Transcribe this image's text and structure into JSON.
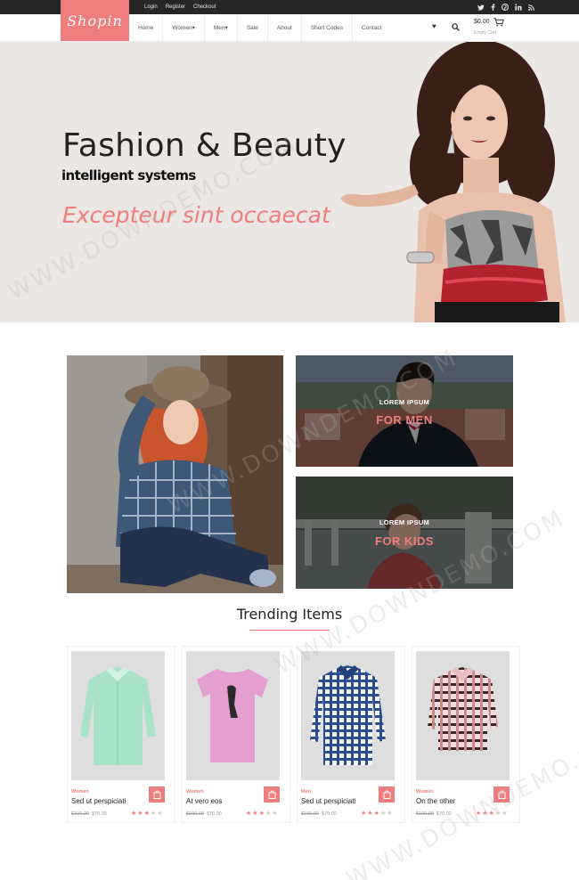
{
  "topbar": {
    "links": [
      "Login",
      "Register",
      "Checkout"
    ],
    "social": [
      "twitter-icon",
      "facebook-icon",
      "pinterest-icon",
      "linkedin-icon",
      "rss-icon"
    ]
  },
  "logo": {
    "text": "Shopin"
  },
  "nav": {
    "items": [
      "Home",
      "Women▾",
      "Men▾",
      "Sale",
      "About",
      "Short Codes",
      "Contact"
    ]
  },
  "cart": {
    "price": "$0.00",
    "status": "Empty Cart"
  },
  "hero": {
    "title": "Fashion & Beauty",
    "subtitle": "intelligent systems",
    "tagline": "Excepteur sint occaecat"
  },
  "promos": {
    "men": {
      "kicker": "LOREM IPSUM",
      "title": "FOR MEN"
    },
    "kids": {
      "kicker": "LOREM IPSUM",
      "title": "FOR KIDS"
    }
  },
  "trending": {
    "title": "Trending Items",
    "products": [
      {
        "category": "Women",
        "name": "Sed ut perspiciati",
        "old_price": "$100.00",
        "price": "$70.00",
        "rating": 3
      },
      {
        "category": "Women",
        "name": "At vero eos",
        "old_price": "$100.00",
        "price": "$70.00",
        "rating": 3
      },
      {
        "category": "Men",
        "name": "Sed ut perspiciati",
        "old_price": "$100.00",
        "price": "$70.00",
        "rating": 3
      },
      {
        "category": "Women",
        "name": "On the other",
        "old_price": "$100.00",
        "price": "$70.00",
        "rating": 3
      }
    ]
  },
  "watermark": "WWW.DOWNDEMO.COM",
  "colors": {
    "accent": "#f07d7d",
    "topbar": "#262626",
    "hero_bg": "#ebe7e4"
  }
}
